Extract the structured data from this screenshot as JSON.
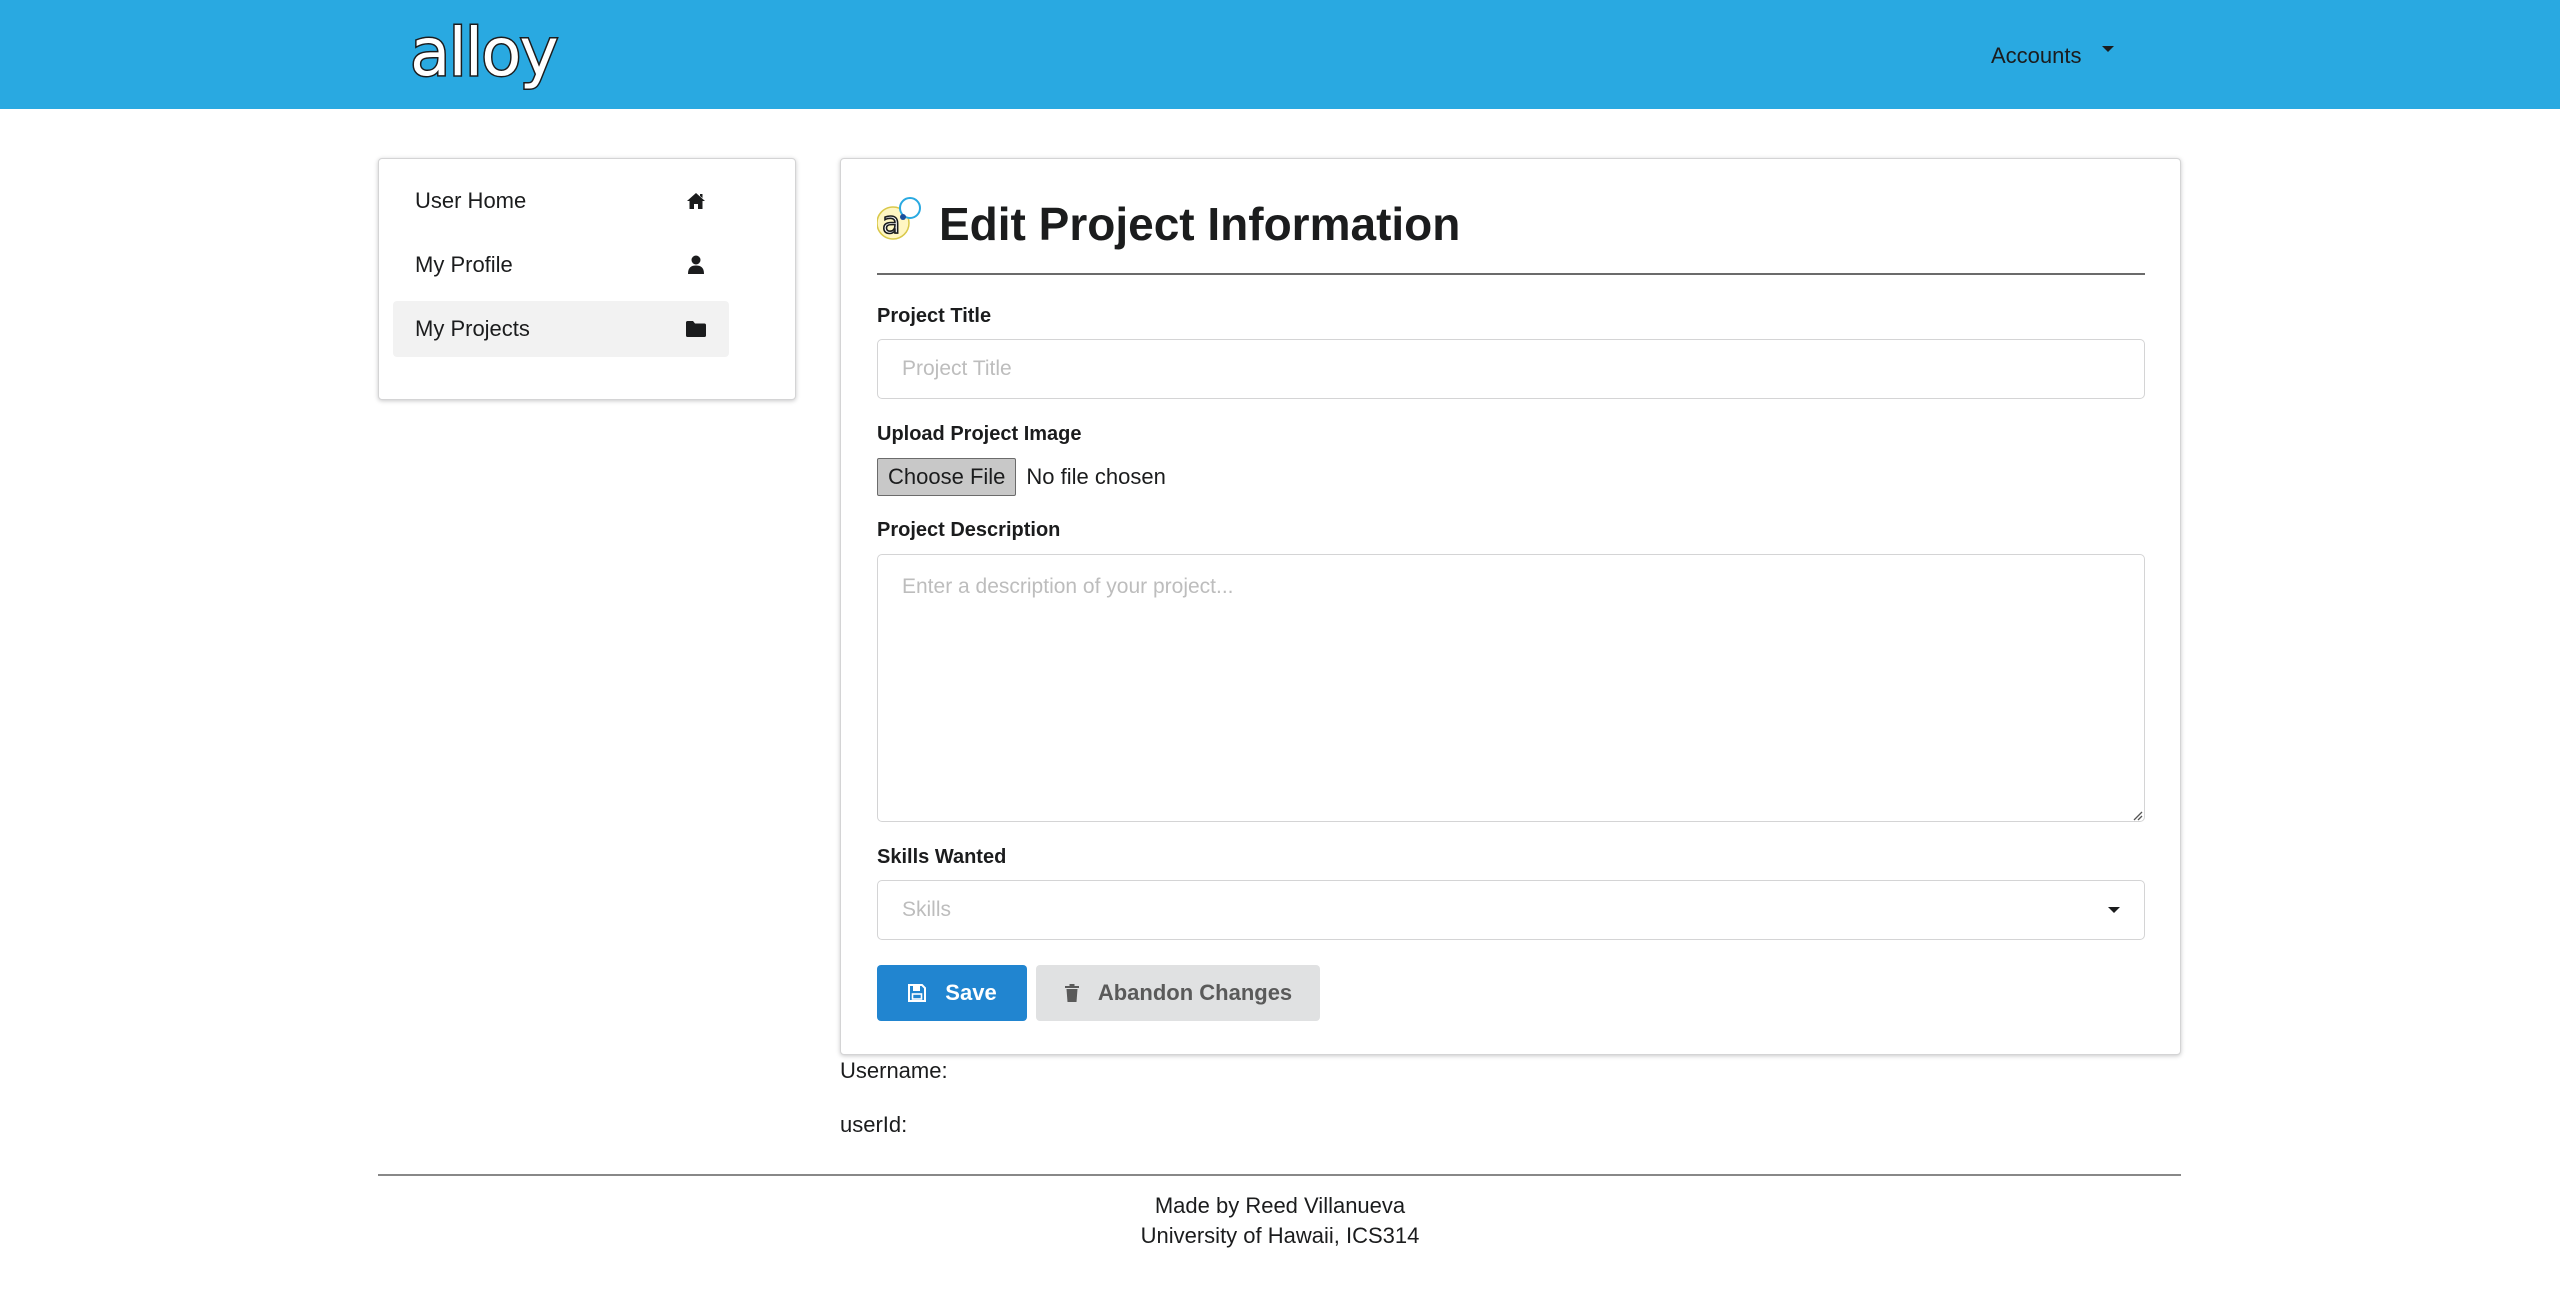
{
  "navbar": {
    "logo_text": "alloy",
    "accounts_label": "Accounts"
  },
  "sidebar": {
    "items": [
      {
        "label": "User Home",
        "icon": "home-icon",
        "active": false
      },
      {
        "label": "My Profile",
        "icon": "user-icon",
        "active": false
      },
      {
        "label": "My Projects",
        "icon": "folder-icon",
        "active": true
      }
    ]
  },
  "form": {
    "title": "Edit Project Information",
    "project_title": {
      "label": "Project Title",
      "placeholder": "Project Title",
      "value": ""
    },
    "image_upload": {
      "label": "Upload Project Image",
      "button_label": "Choose File",
      "status": "No file chosen"
    },
    "description": {
      "label": "Project Description",
      "placeholder": "Enter a description of your project...",
      "value": ""
    },
    "skills": {
      "label": "Skills Wanted",
      "placeholder": "Skills"
    },
    "save_label": "Save",
    "abandon_label": "Abandon Changes"
  },
  "meta": {
    "username_label": "Username:",
    "userid_label": "userId:"
  },
  "footer": {
    "line1": "Made by Reed Villanueva",
    "line2": "University of Hawaii, ICS314"
  },
  "colors": {
    "navbar_bg": "#29a9e1",
    "primary_button": "#2185d0",
    "secondary_button": "#e0e1e2"
  }
}
